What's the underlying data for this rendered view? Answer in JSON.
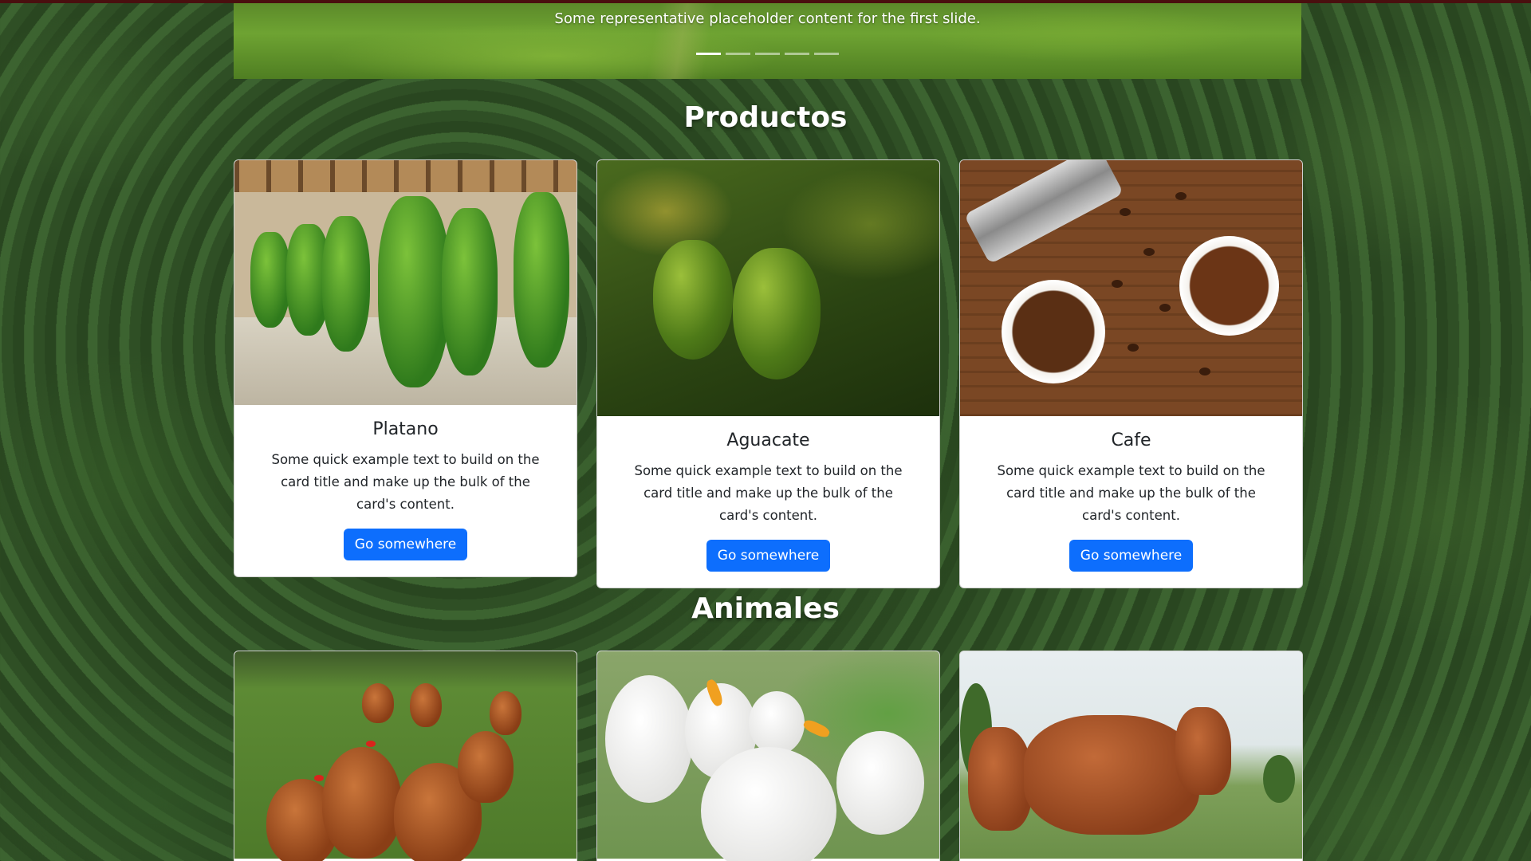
{
  "carousel": {
    "caption": "Some representative placeholder content for the first slide.",
    "indicators": [
      "Slide 1",
      "Slide 2",
      "Slide 3",
      "Slide 4",
      "Slide 5"
    ],
    "active_index": 0
  },
  "sections": {
    "productos": {
      "title": "Productos",
      "cards": [
        {
          "title": "Platano",
          "text": "Some quick example text to build on the card title and make up the bulk of the card's content.",
          "button": "Go somewhere",
          "image": "platano-photo"
        },
        {
          "title": "Aguacate",
          "text": "Some quick example text to build on the card title and make up the bulk of the card's content.",
          "button": "Go somewhere",
          "image": "aguacate-photo"
        },
        {
          "title": "Cafe",
          "text": "Some quick example text to build on the card title and make up the bulk of the card's content.",
          "button": "Go somewhere",
          "image": "cafe-photo"
        }
      ]
    },
    "animales": {
      "title": "Animales",
      "cards": [
        {
          "image": "gallinas-photo"
        },
        {
          "image": "patos-photo"
        },
        {
          "image": "vacas-photo"
        }
      ]
    }
  },
  "colors": {
    "primary_button": "#0d6efd",
    "top_rule": "#4a0f0f",
    "title_text": "#ffffff"
  }
}
